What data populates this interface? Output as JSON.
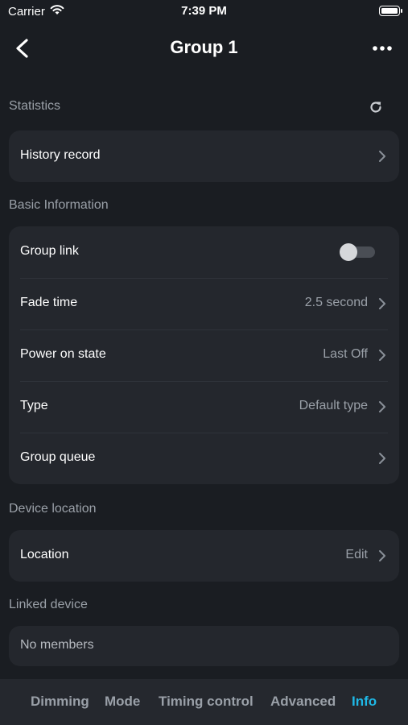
{
  "status_bar": {
    "carrier": "Carrier",
    "time": "7:39 PM"
  },
  "header": {
    "title": "Group 1"
  },
  "statistics": {
    "title": "Statistics",
    "history_label": "History record"
  },
  "basic_info": {
    "title": "Basic Information",
    "group_link_label": "Group link",
    "group_link_on": false,
    "fade_time_label": "Fade time",
    "fade_time_value": "2.5 second",
    "power_on_label": "Power on state",
    "power_on_value": "Last Off",
    "type_label": "Type",
    "type_value": "Default type",
    "group_queue_label": "Group queue"
  },
  "device_location": {
    "title": "Device location",
    "location_label": "Location",
    "location_value": "Edit"
  },
  "linked_device": {
    "title": "Linked device",
    "empty_text": "No members"
  },
  "tabs": [
    {
      "label": "Dimming",
      "active": false
    },
    {
      "label": "Mode",
      "active": false
    },
    {
      "label": "Timing control",
      "active": false
    },
    {
      "label": "Advanced",
      "active": false
    },
    {
      "label": "Info",
      "active": true
    }
  ],
  "colors": {
    "accent": "#1fb8e6",
    "background": "#1a1d22",
    "card": "#24272d"
  },
  "icons": [
    "wifi-icon",
    "battery-icon",
    "back-arrow-icon",
    "more-icon",
    "refresh-icon",
    "chevron-right-icon"
  ]
}
